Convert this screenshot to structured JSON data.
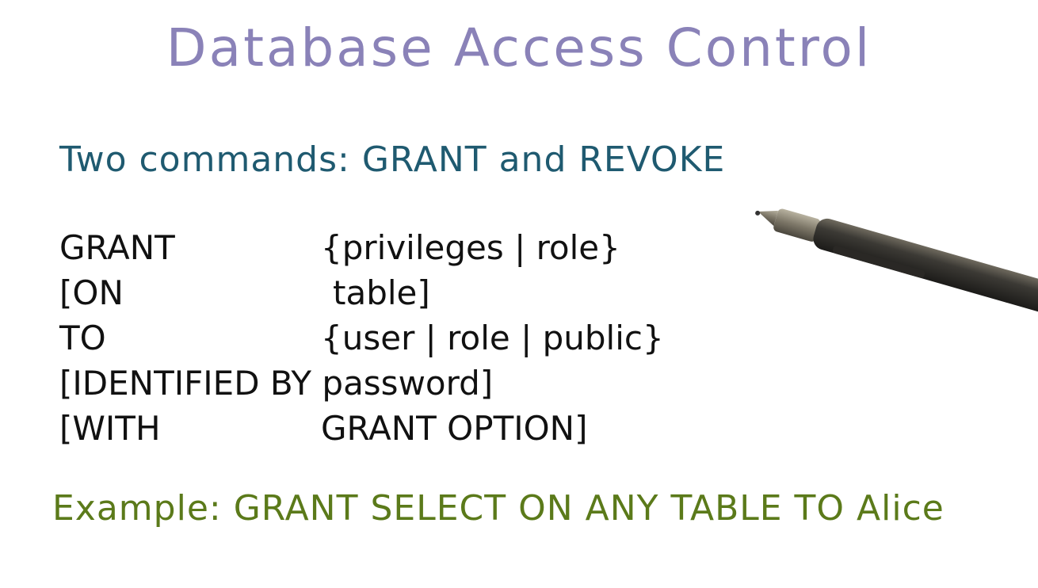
{
  "title": "Database Access Control",
  "subtitle": "Two commands: GRANT and REVOKE",
  "syntax": [
    {
      "keyword": "GRANT",
      "argument": "{privileges | role}"
    },
    {
      "keyword": "[ON",
      "argument": "table]"
    },
    {
      "keyword": "TO",
      "argument": "{user | role | public}"
    },
    {
      "keyword": "[IDENTIFIED BY password]",
      "argument": ""
    },
    {
      "keyword": "[WITH",
      "argument": "GRANT OPTION]"
    }
  ],
  "example": "Example: GRANT SELECT ON ANY TABLE TO Alice",
  "colors": {
    "title": "#8a82b8",
    "subtitle": "#1f5a70",
    "syntax": "#111111",
    "example": "#5b7a1a"
  },
  "icons": [
    "pen-icon"
  ]
}
